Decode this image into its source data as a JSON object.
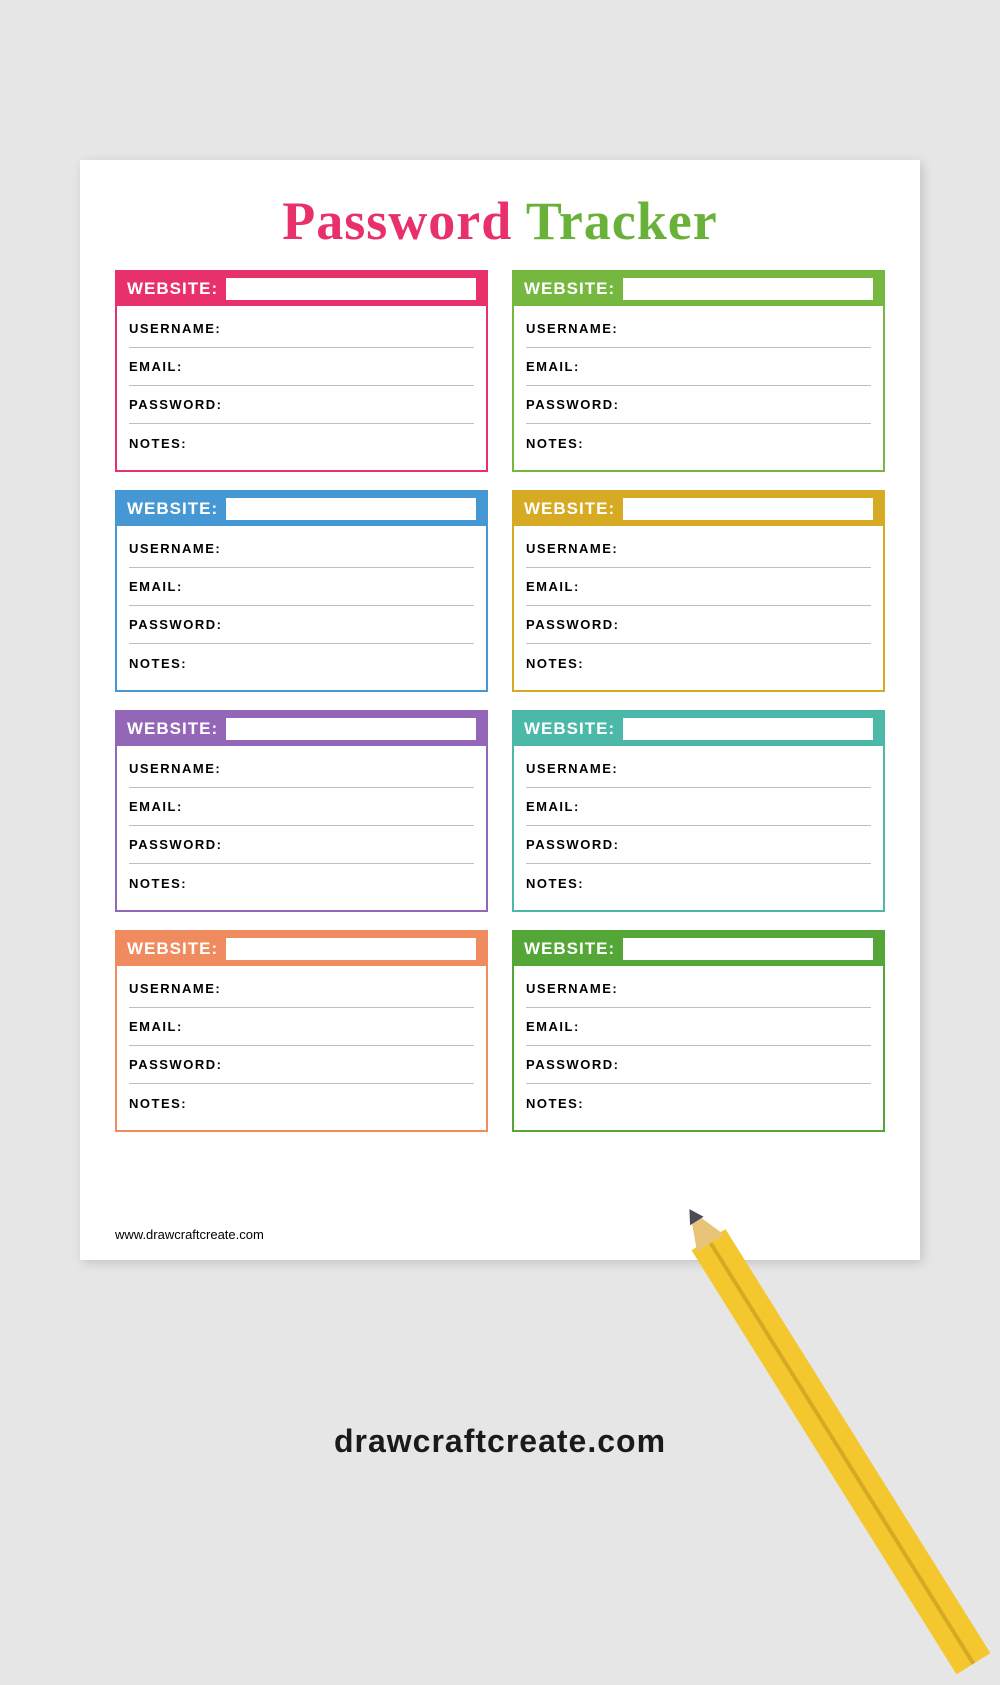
{
  "title": {
    "word1": "Password",
    "word2": "Tracker"
  },
  "header_label": "WEBSITE:",
  "fields": {
    "username": "USERNAME:",
    "email": "EMAIL:",
    "password": "PASSWORD:",
    "notes": "NOTES:"
  },
  "cards": [
    {
      "color": "#e8316a"
    },
    {
      "color": "#76b83f"
    },
    {
      "color": "#4698d4"
    },
    {
      "color": "#d6aa22"
    },
    {
      "color": "#9466b8"
    },
    {
      "color": "#4bb8a8"
    },
    {
      "color": "#f08a5f"
    },
    {
      "color": "#54a637"
    }
  ],
  "footer_url": "www.drawcraftcreate.com",
  "brand": "drawcraftcreate.com"
}
